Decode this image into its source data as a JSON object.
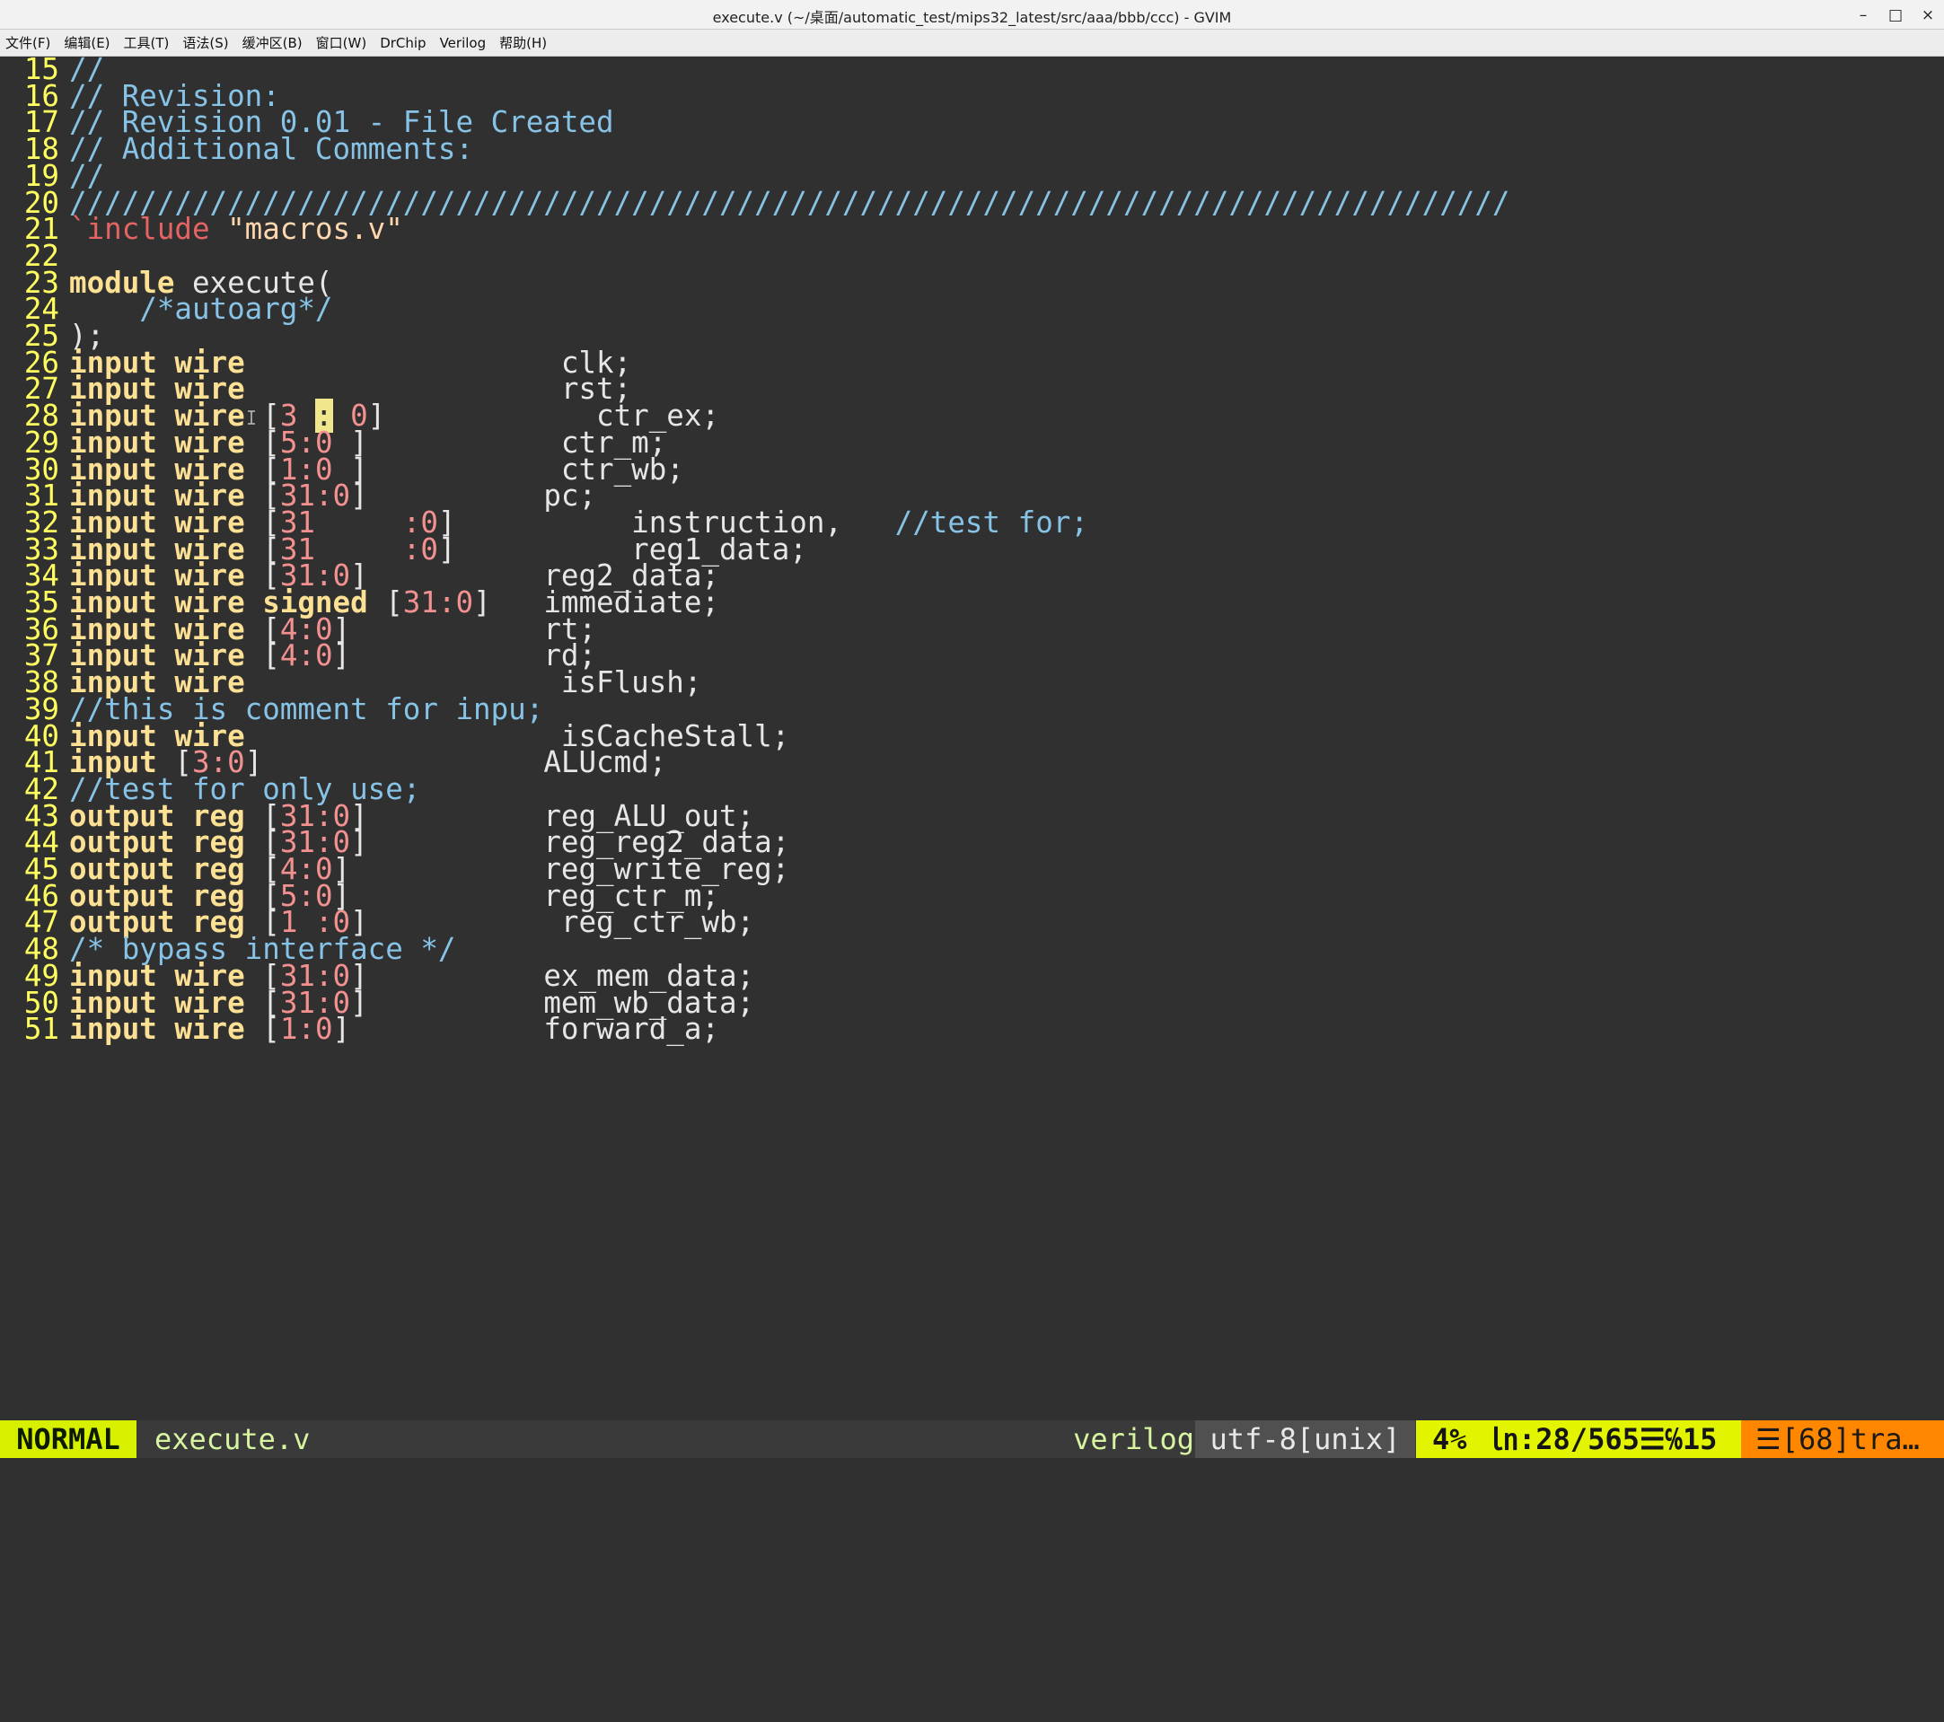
{
  "window": {
    "title": "execute.v (~/桌面/automatic_test/mips32_latest/src/aaa/bbb/ccc) - GVIM",
    "minimize": "–",
    "maximize": "□",
    "close": "×"
  },
  "menu": {
    "items": [
      "文件(F)",
      "编辑(E)",
      "工具(T)",
      "语法(S)",
      "缓冲区(B)",
      "窗口(W)",
      "DrChip",
      "Verilog",
      "帮助(H)"
    ]
  },
  "editor": {
    "lines": [
      {
        "n": "15",
        "segs": [
          [
            "cm",
            "//"
          ]
        ]
      },
      {
        "n": "16",
        "segs": [
          [
            "cm",
            "// Revision:"
          ]
        ]
      },
      {
        "n": "17",
        "segs": [
          [
            "cm",
            "// Revision 0.01 - File Created"
          ]
        ]
      },
      {
        "n": "18",
        "segs": [
          [
            "cm",
            "// Additional Comments:"
          ]
        ]
      },
      {
        "n": "19",
        "segs": [
          [
            "cm",
            "//"
          ]
        ]
      },
      {
        "n": "20",
        "segs": [
          [
            "cm",
            "//////////////////////////////////////////////////////////////////////////////////"
          ]
        ]
      },
      {
        "n": "21",
        "segs": [
          [
            "pp",
            "`include "
          ],
          [
            "str",
            "\"macros.v\""
          ]
        ]
      },
      {
        "n": "22",
        "segs": []
      },
      {
        "n": "23",
        "segs": [
          [
            "kw",
            "module"
          ],
          [
            "tx",
            " execute("
          ]
        ]
      },
      {
        "n": "24",
        "segs": [
          [
            "cm",
            "    /*autoarg*/"
          ]
        ]
      },
      {
        "n": "25",
        "segs": [
          [
            "tx",
            ");"
          ]
        ]
      },
      {
        "n": "26",
        "segs": [
          [
            "kw",
            "input wire"
          ],
          [
            "tx",
            "                  clk;"
          ]
        ]
      },
      {
        "n": "27",
        "segs": [
          [
            "kw",
            "input wire"
          ],
          [
            "tx",
            "                  rst;"
          ]
        ]
      },
      {
        "n": "28",
        "segs": [
          [
            "kw",
            "input wire"
          ],
          [
            "tx",
            " ["
          ],
          [
            "num",
            "3 "
          ],
          [
            "cursor",
            ":"
          ],
          [
            "num",
            " 0"
          ],
          [
            "tx",
            "]            ctr_ex;"
          ]
        ]
      },
      {
        "n": "29",
        "segs": [
          [
            "kw",
            "input wire"
          ],
          [
            "tx",
            " ["
          ],
          [
            "num",
            "5:0 "
          ],
          [
            "tx",
            "]           ctr_m;"
          ]
        ]
      },
      {
        "n": "30",
        "segs": [
          [
            "kw",
            "input wire"
          ],
          [
            "tx",
            " ["
          ],
          [
            "num",
            "1:0 "
          ],
          [
            "tx",
            "]           ctr_wb;"
          ]
        ]
      },
      {
        "n": "31",
        "segs": [
          [
            "kw",
            "input wire"
          ],
          [
            "tx",
            " ["
          ],
          [
            "num",
            "31:0"
          ],
          [
            "tx",
            "]          pc;"
          ]
        ]
      },
      {
        "n": "32",
        "segs": [
          [
            "kw",
            "input wire"
          ],
          [
            "tx",
            " ["
          ],
          [
            "num",
            "31     :0"
          ],
          [
            "tx",
            "]          instruction,   "
          ],
          [
            "cm",
            "//test for;"
          ]
        ]
      },
      {
        "n": "33",
        "segs": [
          [
            "kw",
            "input wire"
          ],
          [
            "tx",
            " ["
          ],
          [
            "num",
            "31     :0"
          ],
          [
            "tx",
            "]          reg1_data;"
          ]
        ]
      },
      {
        "n": "34",
        "segs": [
          [
            "kw",
            "input wire"
          ],
          [
            "tx",
            " ["
          ],
          [
            "num",
            "31:0"
          ],
          [
            "tx",
            "]          reg2_data;"
          ]
        ]
      },
      {
        "n": "35",
        "segs": [
          [
            "kw",
            "input wire signed"
          ],
          [
            "tx",
            " ["
          ],
          [
            "num",
            "31:0"
          ],
          [
            "tx",
            "]   immediate;"
          ]
        ]
      },
      {
        "n": "36",
        "segs": [
          [
            "kw",
            "input wire"
          ],
          [
            "tx",
            " ["
          ],
          [
            "num",
            "4:0"
          ],
          [
            "tx",
            "]           rt;"
          ]
        ]
      },
      {
        "n": "37",
        "segs": [
          [
            "kw",
            "input wire"
          ],
          [
            "tx",
            " ["
          ],
          [
            "num",
            "4:0"
          ],
          [
            "tx",
            "]           rd;"
          ]
        ]
      },
      {
        "n": "38",
        "segs": [
          [
            "kw",
            "input wire"
          ],
          [
            "tx",
            "                  isFlush;"
          ]
        ]
      },
      {
        "n": "39",
        "segs": [
          [
            "cm",
            "//this is comment for inpu;"
          ]
        ]
      },
      {
        "n": "40",
        "segs": [
          [
            "kw",
            "input wire"
          ],
          [
            "tx",
            "                  isCacheStall;"
          ]
        ]
      },
      {
        "n": "41",
        "segs": [
          [
            "kw",
            "input"
          ],
          [
            "tx",
            " ["
          ],
          [
            "num",
            "3:0"
          ],
          [
            "tx",
            "]                ALUcmd;"
          ]
        ]
      },
      {
        "n": "42",
        "segs": [
          [
            "cm",
            "//test for only use;"
          ]
        ]
      },
      {
        "n": "43",
        "segs": [
          [
            "kw",
            "output reg"
          ],
          [
            "tx",
            " ["
          ],
          [
            "num",
            "31:0"
          ],
          [
            "tx",
            "]          reg_ALU_out;"
          ]
        ]
      },
      {
        "n": "44",
        "segs": [
          [
            "kw",
            "output reg"
          ],
          [
            "tx",
            " ["
          ],
          [
            "num",
            "31:0"
          ],
          [
            "tx",
            "]          reg_reg2_data;"
          ]
        ]
      },
      {
        "n": "45",
        "segs": [
          [
            "kw",
            "output reg"
          ],
          [
            "tx",
            " ["
          ],
          [
            "num",
            "4:0"
          ],
          [
            "tx",
            "]           reg_write_reg;"
          ]
        ]
      },
      {
        "n": "46",
        "segs": [
          [
            "kw",
            "output reg"
          ],
          [
            "tx",
            " ["
          ],
          [
            "num",
            "5:0"
          ],
          [
            "tx",
            "]           reg_ctr_m;"
          ]
        ]
      },
      {
        "n": "47",
        "segs": [
          [
            "kw",
            "output reg"
          ],
          [
            "tx",
            " ["
          ],
          [
            "num",
            "1 :0"
          ],
          [
            "tx",
            "]           reg_ctr_wb;"
          ]
        ]
      },
      {
        "n": "48",
        "segs": [
          [
            "cm",
            "/* bypass interface */"
          ]
        ]
      },
      {
        "n": "49",
        "segs": [
          [
            "kw",
            "input wire"
          ],
          [
            "tx",
            " ["
          ],
          [
            "num",
            "31:0"
          ],
          [
            "tx",
            "]          ex_mem_data;"
          ]
        ]
      },
      {
        "n": "50",
        "segs": [
          [
            "kw",
            "input wire"
          ],
          [
            "tx",
            " ["
          ],
          [
            "num",
            "31:0"
          ],
          [
            "tx",
            "]          mem_wb_data;"
          ]
        ]
      },
      {
        "n": "51",
        "segs": [
          [
            "kw",
            "input wire"
          ],
          [
            "tx",
            " ["
          ],
          [
            "num",
            "1:0"
          ],
          [
            "tx",
            "]           forward_a;"
          ]
        ]
      }
    ]
  },
  "status": {
    "mode": "NORMAL",
    "filename": "execute.v",
    "filetype": "verilog",
    "encoding": "utf-8[unix]",
    "percent": "4%",
    "position": "㏑:28/565☰℅15",
    "warning": "☰[68]tra…"
  },
  "colors": {
    "background": "#303030",
    "line_number": "#ffff5f",
    "keyword": "#fce094",
    "comment": "#87c3e6",
    "number": "#f39191",
    "preproc": "#e46464",
    "mode_bg": "#d7f000",
    "position_bg": "#e2f400",
    "warning_bg": "#ff8700"
  }
}
